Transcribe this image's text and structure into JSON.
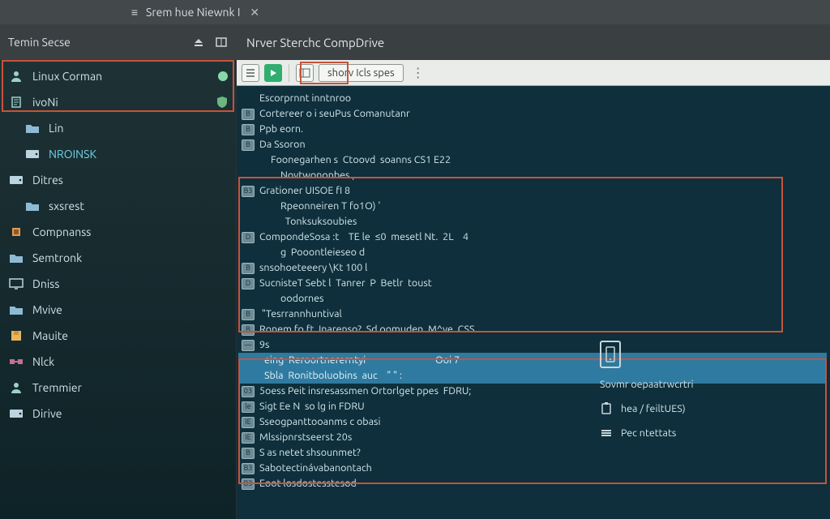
{
  "titlebar": {
    "title": "Srem hue Niewnk I",
    "close_glyph": "✕",
    "bullet_glyph": "≡"
  },
  "header": {
    "left_label": "Temin Secse",
    "right_label": "Nrver Sterchc CompDrive"
  },
  "sidebar": {
    "items": [
      {
        "label": "Linux Corman",
        "icon": "user-icon",
        "badge": "dot"
      },
      {
        "label": "ivoNi",
        "icon": "doc-icon",
        "badge": "shield"
      },
      {
        "label": "Lin",
        "icon": "folder-icon",
        "indent": true
      },
      {
        "label": "NROINSK",
        "icon": "drive-icon",
        "indent": true,
        "selected": true
      },
      {
        "label": "Ditres",
        "icon": "drive-icon"
      },
      {
        "label": "sxsrest",
        "icon": "folder-icon",
        "indent": true
      },
      {
        "label": "Compnanss",
        "icon": "chip-icon"
      },
      {
        "label": "Semtronk",
        "icon": "folder-icon"
      },
      {
        "label": "Dniss",
        "icon": "monitor-icon"
      },
      {
        "label": "Mvive",
        "icon": "folder-icon"
      },
      {
        "label": "Mauite",
        "icon": "disk-icon"
      },
      {
        "label": "Nlck",
        "icon": "net-icon"
      },
      {
        "label": "Tremmier",
        "icon": "user-icon"
      },
      {
        "label": "Dirive",
        "icon": "drive-icon"
      }
    ]
  },
  "tabs": {
    "icon1": "list-icon",
    "icon2": "play-icon",
    "icon3": "panel-icon",
    "label": "shorv Icls spes",
    "tail": "⋮"
  },
  "terminal": {
    "lines": [
      {
        "b": "",
        "t": "Escorprnnt inntnroo"
      },
      {
        "b": "B",
        "t": "Cortereer o i seuPus Comanutanr"
      },
      {
        "b": "B",
        "t": "Ppb eorn."
      },
      {
        "b": "B",
        "t": "Da Ssoron"
      },
      {
        "b": "",
        "t": "Foonegarhen s  Ctoovd  soanns CS1 E22",
        "half": true
      },
      {
        "b": "",
        "t": "Novtwononbes ,",
        "indent": true
      },
      {
        "b": "B3",
        "t": "Grationer UISOE fI 8"
      },
      {
        "b": "",
        "t": "Rpeonneiren T fo1O) '",
        "indent": true
      },
      {
        "b": "",
        "t": "  Tonksuksoubies",
        "indent": true
      },
      {
        "b": "D",
        "t": "CompondeSosa :t    TE le  ≤0  mesetl Nt.  2L    4"
      },
      {
        "b": "",
        "t": "g  Pooontleieseo d",
        "indent": true
      },
      {
        "b": "B",
        "t": "snsohoeteeery \\Kt 100 l"
      },
      {
        "b": "D",
        "t": "SucnisteT Sebt l  Tanrer  P  Betlr  toust"
      },
      {
        "b": "",
        "t": "oodornes",
        "indent": true
      },
      {
        "b": "B",
        "t": " \"Tesrrannhuntival"
      },
      {
        "b": "B",
        "t": "Ronem fo ft  Inarenso?  Sd oomuden  M^ve  CSS"
      },
      {
        "b": "—",
        "t": "9s"
      },
      {
        "b": "",
        "t": "eing  Reroortnererntyi                              Ooi 7",
        "sel": true
      },
      {
        "b": "",
        "t": "Sbla  Ronitboluobins  auc    \" \" :",
        "sel": true
      },
      {
        "b": "03",
        "t": "5oess Peit insresassmen Ortorlget ppes  FDRU;"
      },
      {
        "b": "le",
        "t": "Sigt Ee N  so lg in FDRU"
      },
      {
        "b": "IE",
        "t": "Sseogpanttooanms c obasi"
      },
      {
        "b": "IE",
        "t": "Mlssipnrstseerst 20s"
      },
      {
        "b": "B",
        "t": "S as netet shsounmet?"
      },
      {
        "b": "B3",
        "t": "Sabotectinávabanontach"
      },
      {
        "b": "B3",
        "t": "Eoot losdostesstesod"
      }
    ]
  },
  "right_panel": {
    "row1": "Sovmr oepaatrwcrtri",
    "row2": "hea / feiltUES)",
    "row3": "Pec ntettats"
  }
}
